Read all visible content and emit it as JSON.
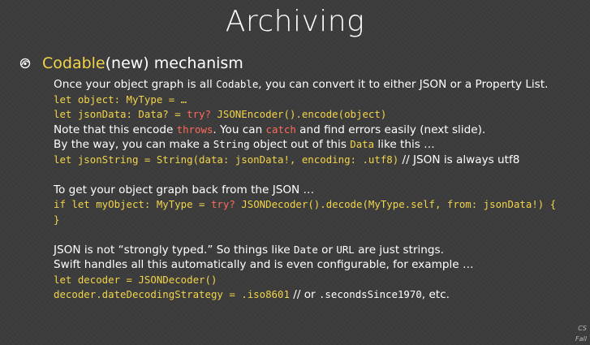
{
  "slide": {
    "title": "Archiving",
    "bullet": {
      "keyword": "Codable",
      "rest": " (new) mechanism"
    },
    "lines": {
      "l1_a": "Once your object graph is all ",
      "l1_b": "Codable",
      "l1_c": ", you can convert it to either JSON or a Property List.",
      "l2": "let object: MyType = …",
      "l3_a": "let jsonData: Data? = ",
      "l3_b": "try?",
      "l3_c": " JSONEncoder().encode(object)",
      "l4_a": "Note that this encode ",
      "l4_b": "throws",
      "l4_c": ".  You can ",
      "l4_d": "catch",
      "l4_e": " and find errors easily (next slide).",
      "l5_a": "By the way, you can make a ",
      "l5_b": "String",
      "l5_c": " object out of this ",
      "l5_d": "Data",
      "l5_e": " like this …",
      "l6_a": "let jsonString = String(data: jsonData!, encoding: .utf8)",
      "l6_b": " // JSON is always utf8",
      "l7": "To get your object graph back from the JSON …",
      "l8_a": "if let myObject: MyType = ",
      "l8_b": "try?",
      "l8_c": " JSONDecoder().decode(MyType.self, from: jsonData!) {",
      "l9": "}",
      "l10": "JSON is not “strongly typed.”  So things like ",
      "l10_b": "Date",
      "l10_c": " or ",
      "l10_d": "URL",
      "l10_e": " are just strings.",
      "l11": "Swift handles all this automatically and is even configurable, for example …",
      "l12": "let decoder = JSONDecoder()",
      "l13_a": "decoder.dateDecodingStrategy = .iso8601",
      "l13_b": " // or ",
      "l13_c": ".secondsSince1970",
      "l13_d": ", etc."
    },
    "corner": {
      "line1": "CS",
      "line2": "Fall"
    }
  },
  "colors": {
    "background": "#3c3c3c",
    "text": "#ffffff",
    "code": "#f2d44a",
    "keyword_red": "#ff6a5a"
  },
  "icons": {
    "bullet": "swirl-bullet-icon"
  }
}
